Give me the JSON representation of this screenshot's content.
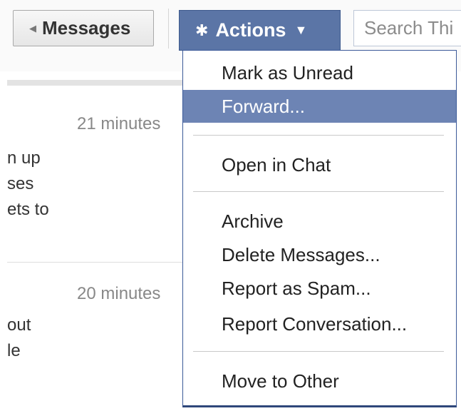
{
  "toolbar": {
    "messages_label": "Messages",
    "actions_label": "Actions",
    "search_placeholder": "Search Thi"
  },
  "messages": [
    {
      "time": "21 minutes",
      "lines": [
        "n up",
        "ses",
        "ets to"
      ]
    },
    {
      "time": "20 minutes",
      "lines": [
        "out",
        "le"
      ]
    }
  ],
  "menu": {
    "items": [
      "Mark as Unread",
      "Forward...",
      "Open in Chat",
      "Archive",
      "Delete Messages...",
      "Report as Spam...",
      "Report Conversation...",
      "Move to Other"
    ],
    "highlighted_item": "Forward..."
  },
  "colors": {
    "actions_bg": "#5b75a6",
    "highlight": "#6d84b4",
    "border": "#3b5998"
  },
  "icons": {
    "messages_back": "chevron-left-icon",
    "actions": "gear-icon",
    "actions_caret": "caret-down-icon"
  }
}
